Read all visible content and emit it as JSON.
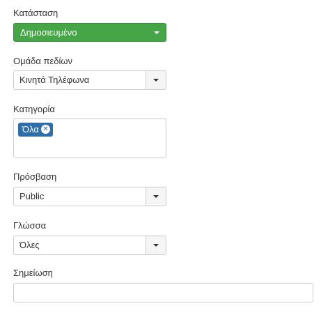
{
  "status": {
    "label": "Κατάσταση",
    "value": "Δημοσιευμένο",
    "color": "#46a546"
  },
  "field_group": {
    "label": "Ομάδα πεδίων",
    "value": "Κινητά Τηλέφωνα"
  },
  "category": {
    "label": "Κατηγορία",
    "chips": [
      "Όλα"
    ],
    "chip_color": "#2f6ea9",
    "chip_close_icon": "close-circle-icon"
  },
  "access": {
    "label": "Πρόσβαση",
    "value": "Public"
  },
  "language": {
    "label": "Γλώσσα",
    "value": "Όλες"
  },
  "note": {
    "label": "Σημείωση",
    "value": ""
  }
}
